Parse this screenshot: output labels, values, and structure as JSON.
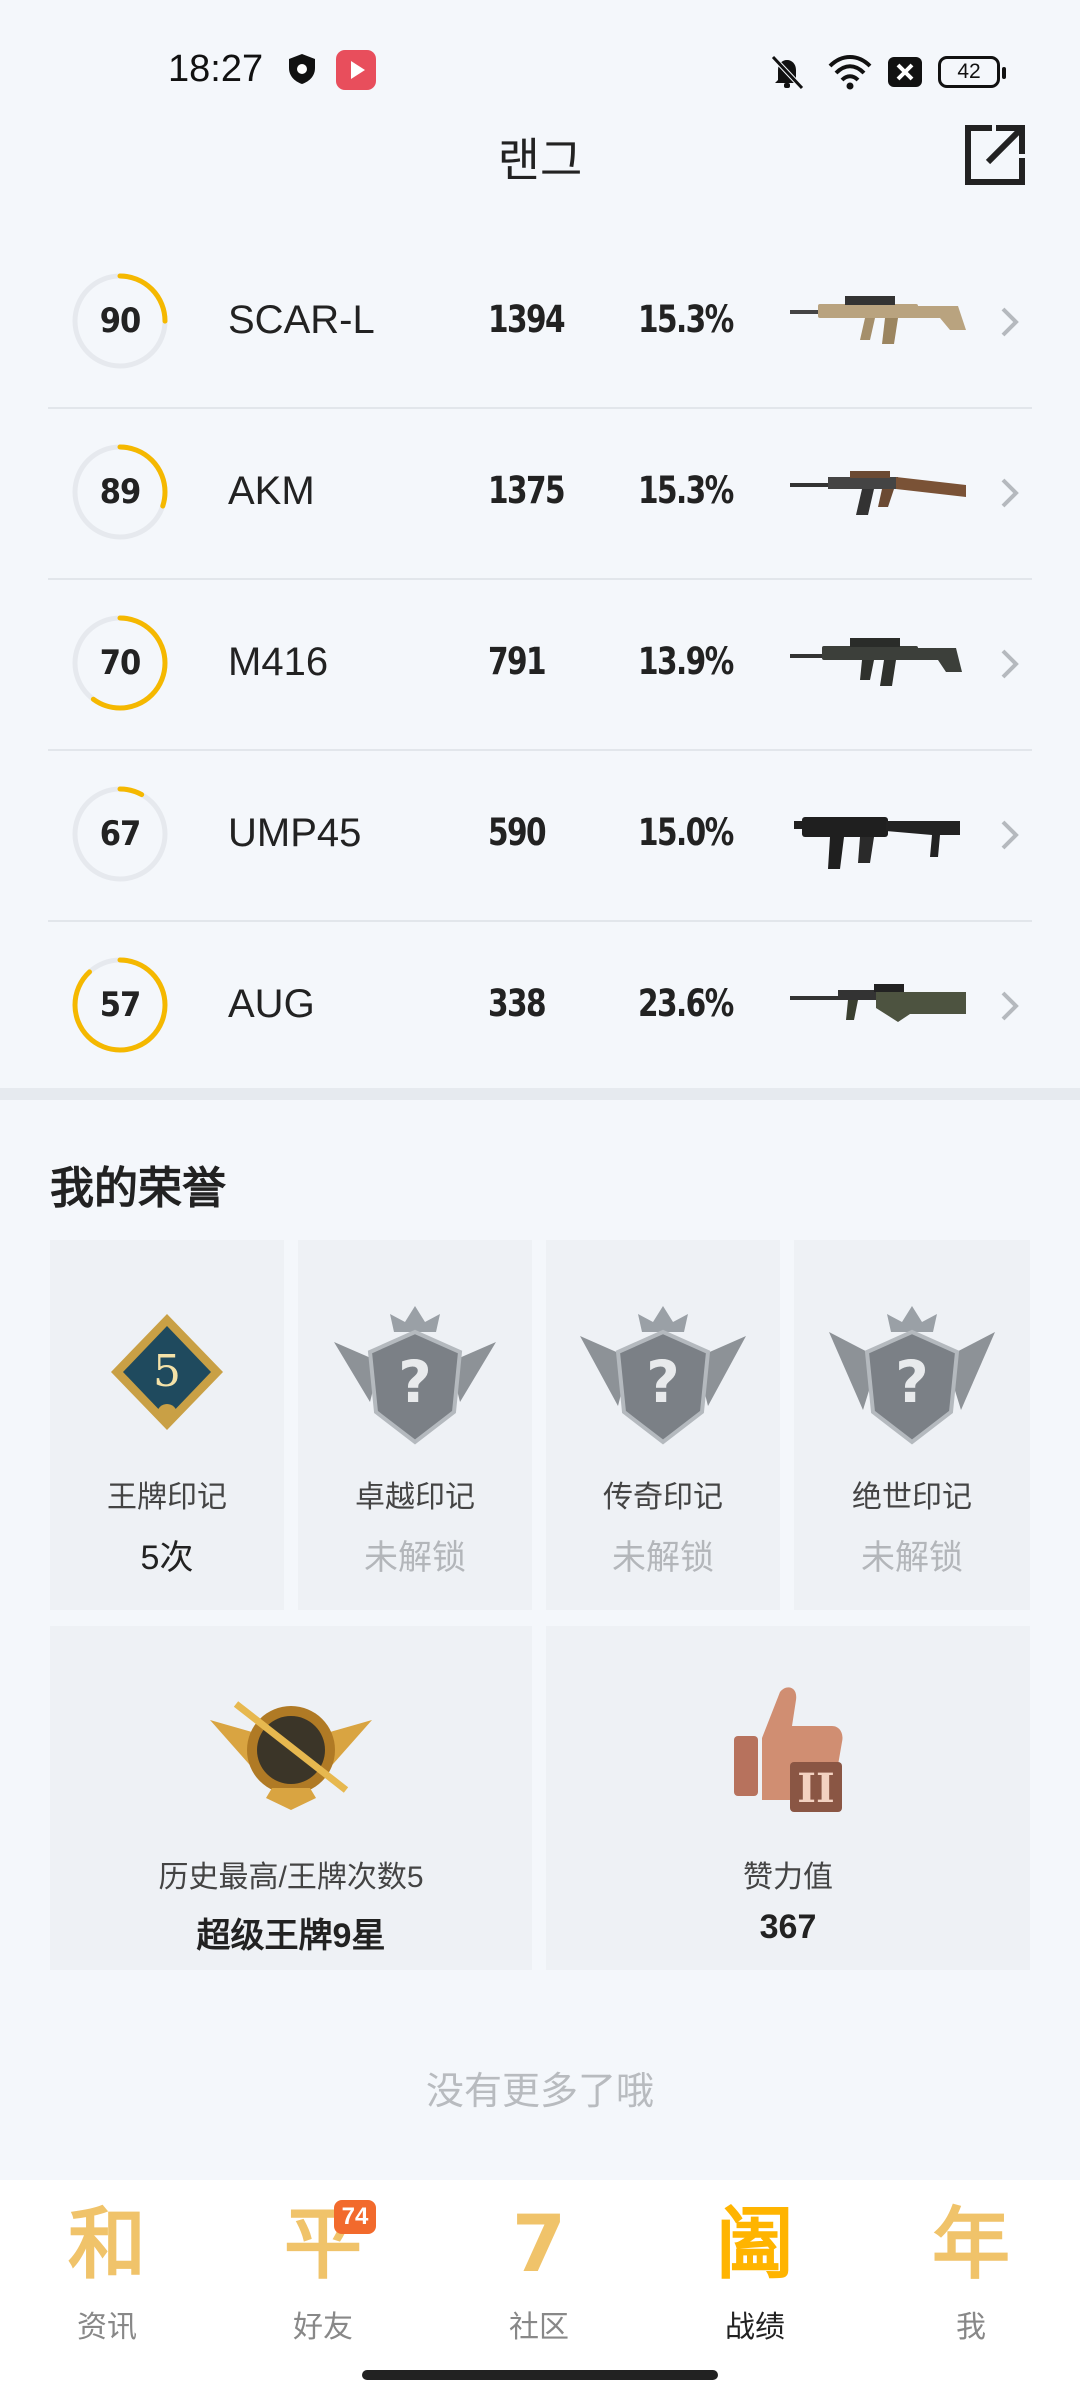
{
  "status_bar": {
    "time": "18:27",
    "battery": "42"
  },
  "header": {
    "title": "랜그"
  },
  "weapons": [
    {
      "score": 90,
      "score_progress": 0.25,
      "name": "SCAR-L",
      "count": "1394",
      "rate": "15.3%",
      "image": "scar-l-rifle-icon"
    },
    {
      "score": 89,
      "score_progress": 0.3,
      "name": "AKM",
      "count": "1375",
      "rate": "15.3%",
      "image": "akm-rifle-icon"
    },
    {
      "score": 70,
      "score_progress": 0.6,
      "name": "M416",
      "count": "791",
      "rate": "13.9%",
      "image": "m416-rifle-icon"
    },
    {
      "score": 67,
      "score_progress": 0.08,
      "name": "UMP45",
      "count": "590",
      "rate": "15.0%",
      "image": "ump45-smg-icon"
    },
    {
      "score": 57,
      "score_progress": 0.88,
      "name": "AUG",
      "count": "338",
      "rate": "23.6%",
      "image": "aug-rifle-icon"
    }
  ],
  "honors": {
    "title": "我的荣誉",
    "badges": [
      {
        "label": "王牌印记",
        "value": "5次",
        "locked": false,
        "badge_number": "5"
      },
      {
        "label": "卓越印记",
        "value": "未解锁",
        "locked": true
      },
      {
        "label": "传奇印记",
        "value": "未解锁",
        "locked": true
      },
      {
        "label": "绝世印记",
        "value": "未解锁",
        "locked": true
      }
    ],
    "highest": {
      "label": "历史最高/王牌次数5",
      "value": "超级王牌9星"
    },
    "likes": {
      "label": "赞力值",
      "value": "367"
    }
  },
  "end_text": "没有更多了哦",
  "bottom_nav": [
    {
      "label": "资讯",
      "glyph": "和",
      "active": false
    },
    {
      "label": "好友",
      "glyph": "平",
      "active": false,
      "badge": "74"
    },
    {
      "label": "社区",
      "glyph": "7",
      "active": false
    },
    {
      "label": "战绩",
      "glyph": "阖",
      "active": true
    },
    {
      "label": "我",
      "glyph": "年",
      "active": false
    }
  ],
  "colors": {
    "accent": "#f5b800",
    "ring_track": "#e6e9ee",
    "nav_glyph": "#f0c36a",
    "badge": "#f26a2c"
  }
}
